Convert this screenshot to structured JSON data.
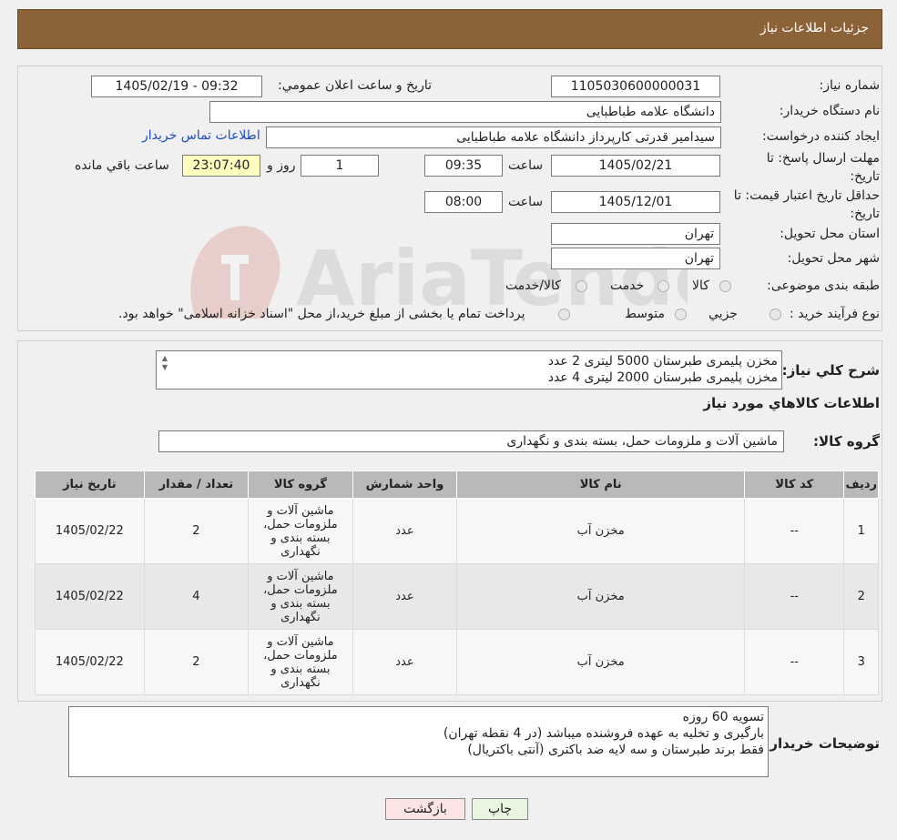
{
  "header": {
    "title": "جزئیات اطلاعات نیاز"
  },
  "watermark": {
    "text": "AriaTender.neT"
  },
  "form": {
    "need_number_label": "شماره نیاز:",
    "need_number": "1105030600000031",
    "announce_label": "تاریخ و ساعت اعلان عمومي:",
    "announce_value": "1405/02/19 - 09:32",
    "buyer_org_label": "نام دستگاه خریدار:",
    "buyer_org": "دانشگاه علامه طباطبایی",
    "creator_label": "ایجاد کننده درخواست:",
    "creator": "سیدامیر قدرتی کارپرداز دانشگاه علامه طباطبایی",
    "contact_link": "اطلاعات تماس خریدار",
    "deadline_label": "مهلت ارسال پاسخ: تا تاریخ:",
    "deadline_date": "1405/02/21",
    "time_label": "ساعت",
    "deadline_time": "09:35",
    "days_value": "1",
    "days_label": "روز و",
    "remaining_time": "23:07:40",
    "remaining_label": "ساعت باقي مانده",
    "validity_label": "حداقل تاریخ اعتبار قیمت: تا تاریخ:",
    "validity_date": "1405/12/01",
    "validity_time": "08:00",
    "province_label": "استان محل تحویل:",
    "province": "تهران",
    "city_label": "شهر محل تحویل:",
    "city": "تهران",
    "category_label": "طبقه بندی موضوعی:",
    "category_options": [
      "کالا",
      "خدمت",
      "کالا/خدمت"
    ],
    "process_label": "نوع فرآیند خرید :",
    "process_options": [
      "جزیي",
      "متوسط"
    ],
    "process_note": "پرداخت تمام یا بخشی از مبلغ خرید،از محل \"اسناد خزانه اسلامی\" خواهد بود."
  },
  "summary": {
    "label": "شرح کلي نیاز:",
    "lines": [
      "مخزن پلیمری طبرستان 5000 لیتری 2 عدد",
      "مخزن پلیمری طبرستان 2000 لیتری 4 عدد"
    ],
    "goods_info_title": "اطلاعات کالاهاي مورد نیاز",
    "group_label": "گروه کالا:",
    "group_value": "ماشین آلات و ملزومات حمل، بسته بندی و نگهداری"
  },
  "table": {
    "headers": [
      "ردیف",
      "کد کالا",
      "نام کالا",
      "واحد شمارش",
      "گروه کالا",
      "تعداد / مقدار",
      "تاریخ نیاز"
    ],
    "rows": [
      [
        "1",
        "--",
        "مخزن آب",
        "عدد",
        "ماشین آلات و ملزومات حمل، بسته بندی و نگهداری",
        "2",
        "1405/02/22"
      ],
      [
        "2",
        "--",
        "مخزن آب",
        "عدد",
        "ماشین آلات و ملزومات حمل، بسته بندی و نگهداری",
        "4",
        "1405/02/22"
      ],
      [
        "3",
        "--",
        "مخزن آب",
        "عدد",
        "ماشین آلات و ملزومات حمل، بسته بندی و نگهداری",
        "2",
        "1405/02/22"
      ]
    ]
  },
  "buyer_notes": {
    "label": "توضیحات خریدار:",
    "lines": [
      "تسویه 60 روزه",
      "بارگیری و تخلیه به عهده فروشنده میباشد (در 4 نقطه تهران)",
      "فقط برند طبرستان و سه لایه ضد باکتری (آنتی باکتریال)"
    ]
  },
  "buttons": {
    "print": "چاپ",
    "back": "بازگشت"
  }
}
